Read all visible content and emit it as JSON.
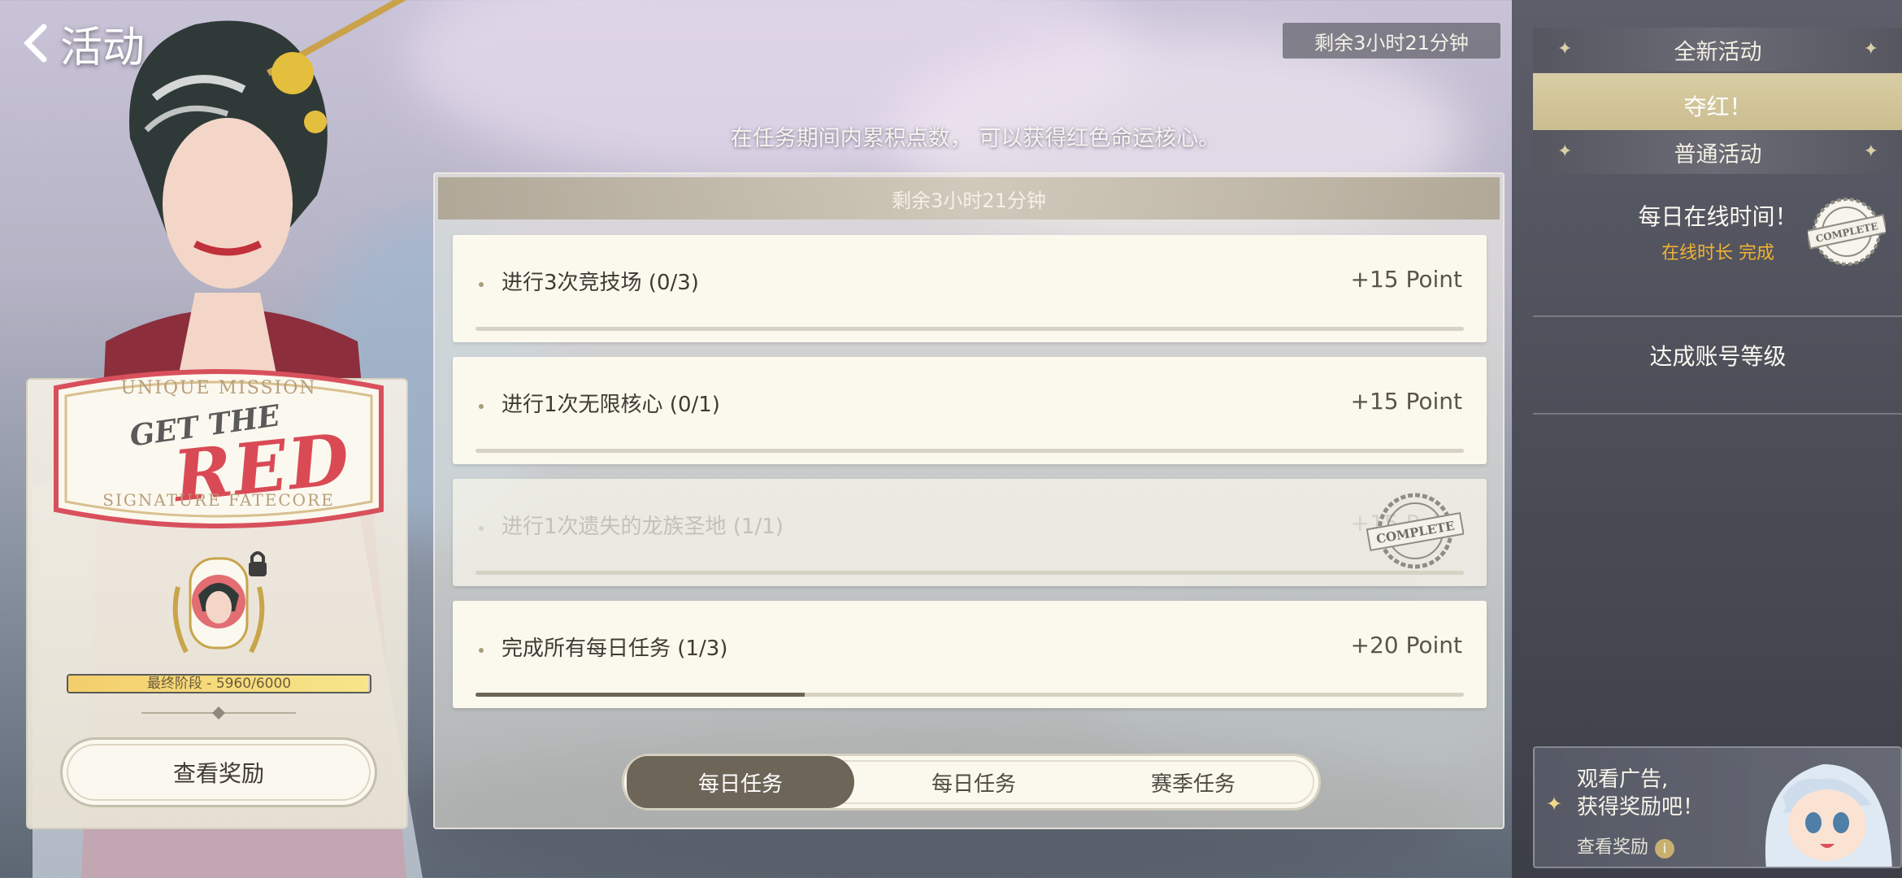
{
  "header": {
    "title": "活动",
    "back_icon": "chevron-left-icon"
  },
  "timer": {
    "remaining": "剩余3小时21分钟"
  },
  "event": {
    "description": "在任务期间内累积点数， 可以获得红色命运核心。",
    "emblem": {
      "top_text": "UNIQUE MISSION",
      "main_line1": "GET THE",
      "main_line2": "RED",
      "bottom_text": "SIGNATURE FATECORE"
    },
    "progress": {
      "label": "最终阶段 - 5960/6000",
      "current": 5960,
      "max": 6000
    },
    "rewards_button": "查看奖励"
  },
  "panel": {
    "header": "剩余3小时21分钟",
    "tasks": [
      {
        "label": "进行3次竞技场 (0/3)",
        "points": "+15 Point",
        "progress": 0.0,
        "completed": false
      },
      {
        "label": "进行1次无限核心 (0/1)",
        "points": "+15 Point",
        "progress": 0.0,
        "completed": false
      },
      {
        "label": "进行1次遗失的龙族圣地 (1/1)",
        "points": "+15 Point",
        "progress": 1.0,
        "completed": true,
        "stamp": "COMPLETE"
      },
      {
        "label": "完成所有每日任务 (1/3)",
        "points": "+20 Point",
        "progress": 0.333,
        "completed": false
      }
    ],
    "tabs": [
      {
        "label": "每日任务",
        "active": true
      },
      {
        "label": "每日任务",
        "active": false
      },
      {
        "label": "赛季任务",
        "active": false
      }
    ]
  },
  "sidebar": {
    "new_section": "全新活动",
    "new_items": [
      {
        "title": "夺红！",
        "selected": true
      }
    ],
    "normal_section": "普通活动",
    "normal_items": [
      {
        "title": "每日在线时间！",
        "subtitle": "在线时长 完成",
        "stamp": "COMPLETE"
      },
      {
        "title": "达成账号等级"
      }
    ]
  },
  "ad": {
    "title_line1": "观看广告,",
    "title_line2": "获得奖励吧！",
    "link": "查看奖励"
  },
  "colors": {
    "accent_dark": "#6d6558",
    "highlight_gold": "#c9bb8d",
    "complete_orange": "#f2b233",
    "red_emblem": "#d94a55"
  }
}
